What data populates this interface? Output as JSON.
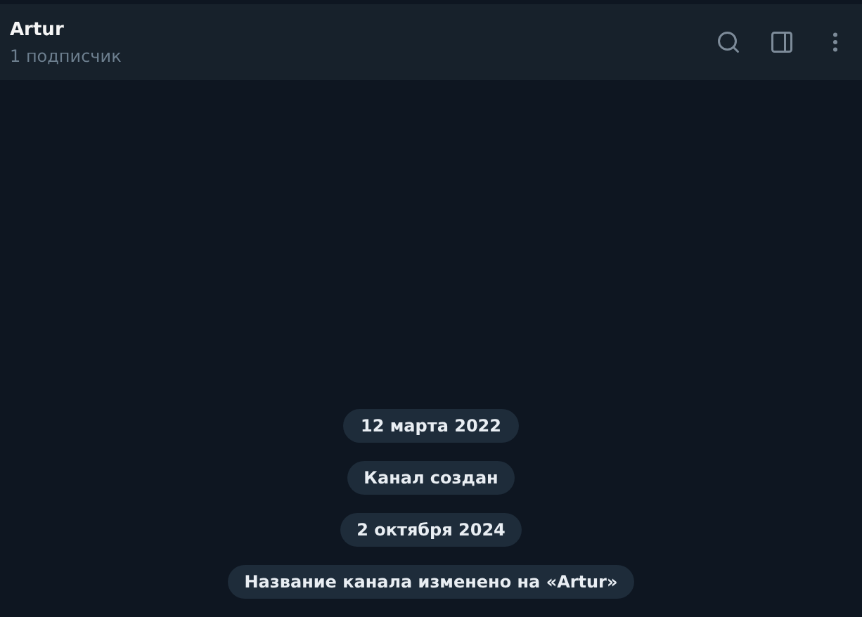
{
  "header": {
    "title": "Artur",
    "subtitle": "1 подписчик"
  },
  "messages": [
    "12 марта 2022",
    "Канал создан",
    "2 октября 2024",
    "Название канала изменено на «Artur»"
  ]
}
